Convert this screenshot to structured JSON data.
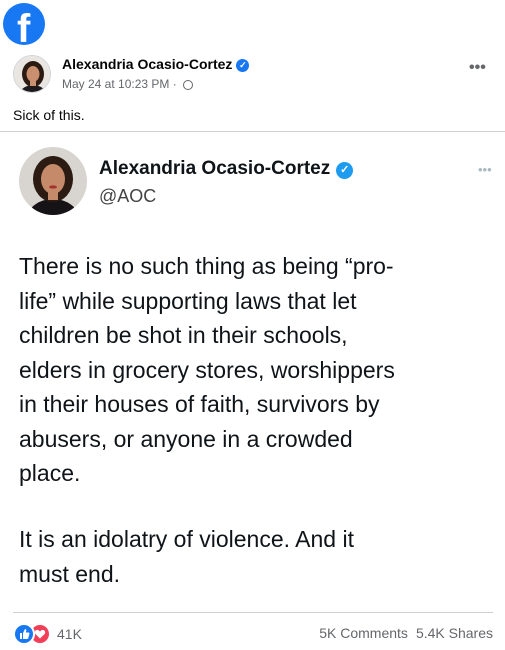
{
  "app": {
    "logo_icon": "facebook-logo-icon",
    "logo_glyph": "f",
    "brand_color": "#1877f2"
  },
  "post": {
    "author": "Alexandria Ocasio-Cortez",
    "timestamp": "May 24 at 10:23 PM",
    "separator": "·",
    "privacy_icon": "globe-icon",
    "more_icon": "more-options-icon",
    "caption": "Sick of this."
  },
  "tweet": {
    "name": "Alexandria Ocasio-Cortez",
    "handle": "@AOC",
    "paragraph1": "There is no such thing as being “pro-\nlife” while supporting laws that let\nchildren be shot in their schools,\nelders in grocery stores, worshippers\nin their houses of faith, survivors by\nabusers, or anyone in a crowded\nplace.",
    "paragraph2": "It is an idolatry of violence. And it\nmust end.",
    "more_icon": "more-options-icon"
  },
  "footer": {
    "reactions_count": "41K",
    "comments": "5K Comments",
    "shares": "5.4K Shares",
    "like_color": "#1877f2",
    "love_color": "#f33e58"
  }
}
